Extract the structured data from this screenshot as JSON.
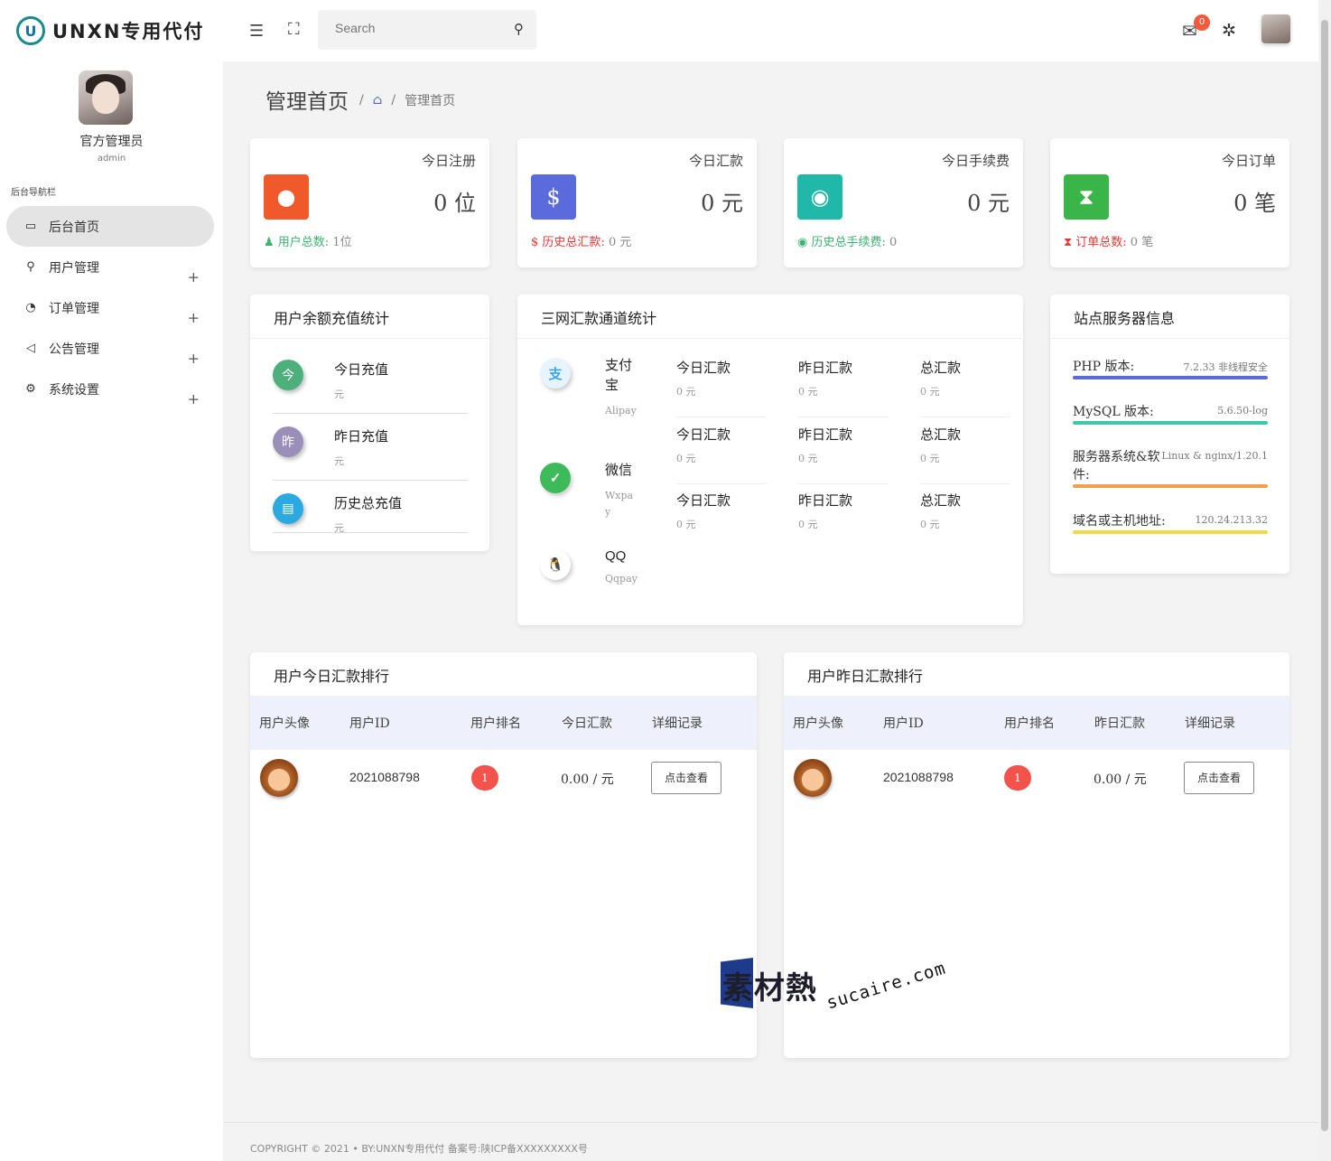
{
  "brand": {
    "logo_text": "UNXN专用代付",
    "logo_mark": "U"
  },
  "profile": {
    "name": "官方管理员",
    "role": "admin"
  },
  "sidebar": {
    "caption": "后台导航栏",
    "items": [
      {
        "label": "后台首页",
        "icon": "monitor-icon",
        "glyph": "▭"
      },
      {
        "label": "用户管理",
        "icon": "user-icon",
        "glyph": "⚲"
      },
      {
        "label": "订单管理",
        "icon": "pie-chart-icon",
        "glyph": "◔"
      },
      {
        "label": "公告管理",
        "icon": "speaker-icon",
        "glyph": "◁"
      },
      {
        "label": "系统设置",
        "icon": "gear-icon",
        "glyph": "⚙"
      }
    ],
    "expand": "+"
  },
  "header": {
    "search_placeholder": "Search",
    "mail_count": "0"
  },
  "breadcrumb": {
    "title": "管理首页",
    "sep": "/",
    "current": "管理首页"
  },
  "stats": [
    {
      "title": "今日注册",
      "value": "0 位",
      "foot_label": "用户总数:",
      "foot_value": "1位",
      "color": "#f05a2a",
      "foot_color": "#3cb371",
      "icon": "user-icon",
      "glyph": "👤"
    },
    {
      "title": "今日汇款",
      "value": "0 元",
      "foot_label": "历史总汇款:",
      "foot_value": "0 元",
      "color": "#5c6bdc",
      "foot_color": "#e53935",
      "icon": "dollar-icon",
      "glyph": "$"
    },
    {
      "title": "今日手续费",
      "value": "0 元",
      "foot_label": "历史总手续费:",
      "foot_value": "0",
      "color": "#20b8a8",
      "foot_color": "#3cb371",
      "icon": "money-icon",
      "glyph": "$"
    },
    {
      "title": "今日订单",
      "value": "0 笔",
      "foot_label": "订单总数:",
      "foot_value": "0 笔",
      "color": "#3ab54a",
      "foot_color": "#e53935",
      "icon": "hourglass-icon",
      "glyph": "⧗"
    }
  ],
  "recharge": {
    "title": "用户余额充值统计",
    "items": [
      {
        "label": "今日充值",
        "unit": "元",
        "color": "#4caf7c",
        "icon": "calendar-today-icon",
        "glyph": "今"
      },
      {
        "label": "昨日充值",
        "unit": "元",
        "color": "#9a8fb8",
        "icon": "calendar-yesterday-icon",
        "glyph": "昨"
      },
      {
        "label": "历史总充值",
        "unit": "元",
        "color": "#2ba9e0",
        "icon": "wallet-icon",
        "glyph": "▤"
      }
    ]
  },
  "channels": {
    "title": "三网汇款通道统计",
    "rows": [
      {
        "name": "支付宝",
        "sub": "Alipay",
        "icon": "alipay-icon",
        "glyph": "支",
        "color": "#3fa3e8",
        "bg": "#e8f4fd",
        "cells": [
          {
            "label": "今日汇款",
            "value": "0 元"
          },
          {
            "label": "昨日汇款",
            "value": "0 元"
          },
          {
            "label": "总汇款",
            "value": "0 元"
          }
        ]
      },
      {
        "name": "微信",
        "sub": "Wxpay",
        "icon": "wechat-icon",
        "glyph": "✓",
        "color": "#fff",
        "bg": "#3dbb5a",
        "cells": [
          {
            "label": "今日汇款",
            "value": "0 元"
          },
          {
            "label": "昨日汇款",
            "value": "0 元"
          },
          {
            "label": "总汇款",
            "value": "0 元"
          }
        ]
      },
      {
        "name": "QQ",
        "sub": "Qqpay",
        "icon": "qq-icon",
        "glyph": "🐧",
        "color": "#111",
        "bg": "#fff",
        "cells": [
          {
            "label": "今日汇款",
            "value": "0 元"
          },
          {
            "label": "昨日汇款",
            "value": "0 元"
          },
          {
            "label": "总汇款",
            "value": "0 元"
          }
        ]
      }
    ]
  },
  "server": {
    "title": "站点服务器信息",
    "rows": [
      {
        "key": "PHP 版本:",
        "value": "7.2.33 非线程安全",
        "bar": "#5c6bdc"
      },
      {
        "key": "MySQL 版本:",
        "value": "5.6.50-log",
        "bar": "#3cc9a8"
      },
      {
        "key": "服务器系统&软件:",
        "value": "Linux & nginx/1.20.1",
        "bar": "#f0a050"
      },
      {
        "key": "域名或主机地址:",
        "value": "120.24.213.32",
        "bar": "#f5d84a"
      }
    ]
  },
  "rank_today": {
    "title": "用户今日汇款排行",
    "headers": [
      "用户头像",
      "用户ID",
      "用户排名",
      "今日汇款",
      "详细记录"
    ],
    "rows": [
      {
        "uid": "2021088798",
        "rank": "1",
        "amount": "0.00 / 元",
        "action": "点击查看"
      }
    ]
  },
  "rank_yesterday": {
    "title": "用户昨日汇款排行",
    "headers": [
      "用户头像",
      "用户ID",
      "用户排名",
      "昨日汇款",
      "详细记录"
    ],
    "rows": [
      {
        "uid": "2021088798",
        "rank": "1",
        "amount": "0.00 / 元",
        "action": "点击查看"
      }
    ]
  },
  "footer": {
    "text": "COPYRIGHT © 2021 • BY:UNXN专用代付   备案号:陕ICP备XXXXXXXXX号"
  },
  "watermark": {
    "cn": "素材熱",
    "en": "sucaire.com"
  }
}
